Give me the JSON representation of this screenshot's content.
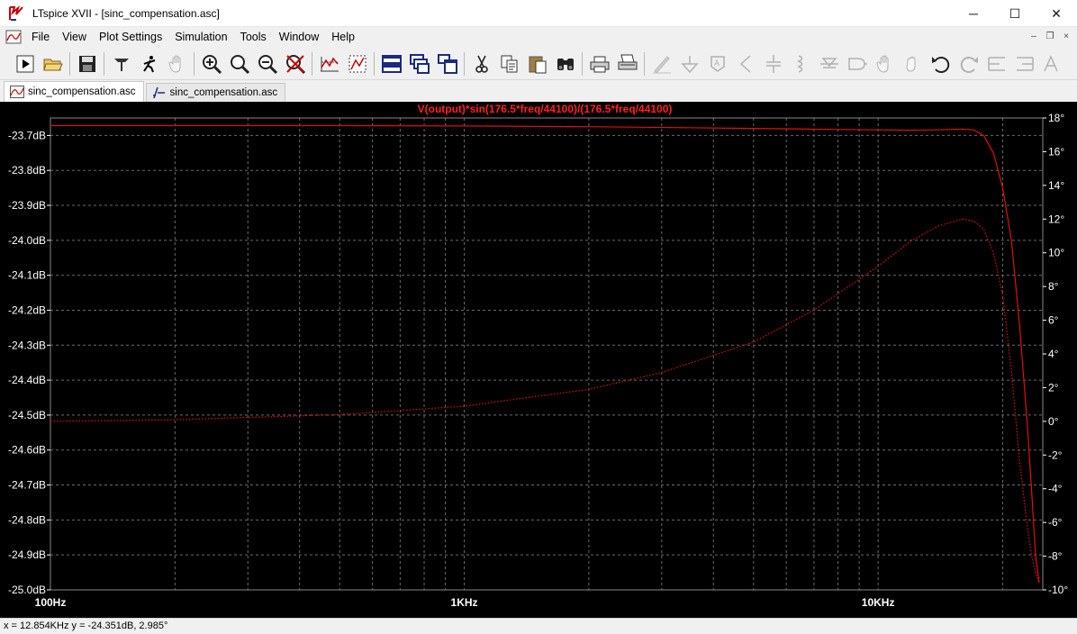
{
  "window": {
    "title": "LTspice XVII - [sinc_compensation.asc]",
    "minimize_glyph": "─",
    "maximize_glyph": "☐",
    "close_glyph": "✕"
  },
  "menu": {
    "items": [
      "File",
      "View",
      "Plot Settings",
      "Simulation",
      "Tools",
      "Window",
      "Help"
    ]
  },
  "mdi": {
    "minimize": "–",
    "restore": "❐",
    "close": "×"
  },
  "toolbar": {
    "icons": [
      "run-icon",
      "open-icon",
      "save-icon",
      "control-panel-icon",
      "halt-icon",
      "pan-icon",
      "zoom-in-icon",
      "zoom-area-icon",
      "zoom-out-icon",
      "zoom-cancel-icon",
      "autorange-icon",
      "plot-settings-icon",
      "tile-horizontal-icon",
      "cascade-icon",
      "tile-vertical-icon",
      "cut-icon",
      "copy-icon",
      "paste-icon",
      "find-icon",
      "print-icon",
      "print-preview-icon",
      "draw-wire-icon",
      "ground-icon",
      "label-net-icon",
      "resistor-icon",
      "capacitor-icon",
      "inductor-icon",
      "diode-icon",
      "component-icon",
      "move-icon",
      "drag-icon",
      "undo-icon",
      "redo-icon",
      "rotate-icon",
      "mirror-icon",
      "text-icon"
    ]
  },
  "tabs": [
    {
      "label": "sinc_compensation.asc",
      "kind": "waveform",
      "active": true
    },
    {
      "label": "sinc_compensation.asc",
      "kind": "schematic",
      "active": false
    }
  ],
  "colors": {
    "trace": "#e01010",
    "grid": "#6a6a6a",
    "axis_text": "#ffffff",
    "title_text": "#ff2020",
    "plot_bg": "#000000"
  },
  "chart_data": {
    "type": "line",
    "title": "V(output)*sin(176.5*freq/44100)/(176.5*freq/44100)",
    "x_scale": "log",
    "xlim": [
      100,
      25000
    ],
    "x_ticks": [
      {
        "value": 100,
        "label": "100Hz"
      },
      {
        "value": 1000,
        "label": "1KHz"
      },
      {
        "value": 10000,
        "label": "10KHz"
      }
    ],
    "y_left": {
      "unit": "dB",
      "ylim": [
        -25.0,
        -23.65
      ],
      "ticks": [
        {
          "value": -23.7,
          "label": "-23.7dB"
        },
        {
          "value": -23.8,
          "label": "-23.8dB"
        },
        {
          "value": -23.9,
          "label": "-23.9dB"
        },
        {
          "value": -24.0,
          "label": "-24.0dB"
        },
        {
          "value": -24.1,
          "label": "-24.1dB"
        },
        {
          "value": -24.2,
          "label": "-24.2dB"
        },
        {
          "value": -24.3,
          "label": "-24.3dB"
        },
        {
          "value": -24.4,
          "label": "-24.4dB"
        },
        {
          "value": -24.5,
          "label": "-24.5dB"
        },
        {
          "value": -24.6,
          "label": "-24.6dB"
        },
        {
          "value": -24.7,
          "label": "-24.7dB"
        },
        {
          "value": -24.8,
          "label": "-24.8dB"
        },
        {
          "value": -24.9,
          "label": "-24.9dB"
        },
        {
          "value": -25.0,
          "label": "-25.0dB"
        }
      ]
    },
    "y_right": {
      "unit": "°",
      "ylim": [
        -10,
        18
      ],
      "ticks": [
        {
          "value": 18,
          "label": "18°"
        },
        {
          "value": 16,
          "label": "16°"
        },
        {
          "value": 14,
          "label": "14°"
        },
        {
          "value": 12,
          "label": "12°"
        },
        {
          "value": 10,
          "label": "10°"
        },
        {
          "value": 8,
          "label": "8°"
        },
        {
          "value": 6,
          "label": "6°"
        },
        {
          "value": 4,
          "label": "4°"
        },
        {
          "value": 2,
          "label": "2°"
        },
        {
          "value": 0,
          "label": "0°"
        },
        {
          "value": -2,
          "label": "-2°"
        },
        {
          "value": -4,
          "label": "-4°"
        },
        {
          "value": -6,
          "label": "-6°"
        },
        {
          "value": -8,
          "label": "-8°"
        },
        {
          "value": -10,
          "label": "-10°"
        }
      ]
    },
    "grid": true,
    "series": [
      {
        "axis": "left",
        "style": "solid",
        "x": [
          100,
          500,
          1000,
          2000,
          5000,
          8000,
          10000,
          12000,
          14000,
          16000,
          17000,
          18000,
          19000,
          20000,
          21000,
          22000,
          22500,
          23000,
          23500,
          24000,
          24500
        ],
        "y": [
          -23.672,
          -23.672,
          -23.673,
          -23.675,
          -23.68,
          -23.683,
          -23.684,
          -23.685,
          -23.684,
          -23.682,
          -23.684,
          -23.7,
          -23.75,
          -23.85,
          -24.0,
          -24.25,
          -24.4,
          -24.55,
          -24.72,
          -24.9,
          -24.98
        ]
      },
      {
        "axis": "right",
        "style": "dotted",
        "x": [
          100,
          200,
          500,
          1000,
          2000,
          3000,
          5000,
          7000,
          10000,
          12000,
          14000,
          16000,
          17000,
          18000,
          19000,
          20000,
          21000,
          22000,
          22500,
          23000,
          23500,
          24000,
          24500
        ],
        "y": [
          0.0,
          0.1,
          0.4,
          0.9,
          1.9,
          2.9,
          4.7,
          6.6,
          9.2,
          10.7,
          11.6,
          12.0,
          11.9,
          11.4,
          10.0,
          7.5,
          3.0,
          -2.5,
          -4.5,
          -6.5,
          -8.0,
          -9.0,
          -9.6
        ]
      }
    ]
  },
  "status": {
    "cursor": "x = 12.854KHz    y = -24.351dB, 2.985°"
  }
}
